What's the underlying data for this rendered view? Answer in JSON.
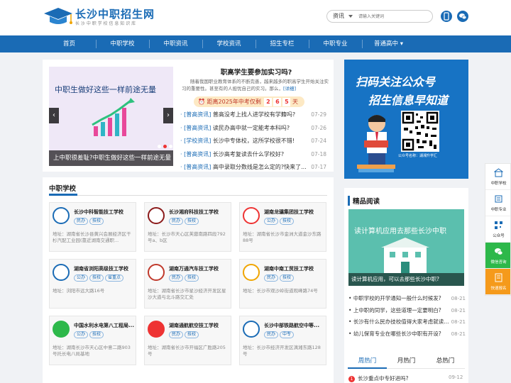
{
  "header": {
    "logo_title": "长沙中职招生网",
    "logo_sub": "长 沙 中 职 学 校 信 息 知 识 库",
    "search_category": "资讯",
    "search_placeholder": "请输入关键词",
    "icons": [
      "mobile-icon",
      "wechat-icon"
    ]
  },
  "nav": {
    "items": [
      "首页",
      "中职学校",
      "中职资讯",
      "学校资讯",
      "招生专栏",
      "中职专业",
      "普通高中"
    ]
  },
  "banner": {
    "title": "中职生做好这些一样前途无量",
    "caption": "上中职很羞耻?中职生做好这些一样前途无量",
    "prev": "‹",
    "next": "›"
  },
  "feature": {
    "title": "职高学生要参加实习吗?",
    "desc": "随着我国职业教育体系的不断完善，越来越多的职高学生开始关注实习的重要性。甚至有的人担忧自己的实习。那么，",
    "more": "[详细]",
    "countdown_label": "距离2025年中考仅剩",
    "countdown_digits": [
      "2",
      "6",
      "5"
    ],
    "countdown_unit": "天"
  },
  "news": [
    {
      "cat": "[普高资讯]",
      "title": "普高没考上找人进学校有学籍吗?",
      "date": "07-29"
    },
    {
      "cat": "[普高资讯]",
      "title": "读民办高中就一定能考本科吗?",
      "date": "07-26"
    },
    {
      "cat": "[学校资讯]",
      "title": "长沙中专体校，这所学校很不错!",
      "date": "07-24"
    },
    {
      "cat": "[普高资讯]",
      "title": "长沙高考复读去什么学校好?",
      "date": "07-18"
    },
    {
      "cat": "[普高资讯]",
      "title": "高中录取分数线是怎么定的?快来了...",
      "date": "07-17"
    }
  ],
  "qr": {
    "line1": "扫码关注公众号",
    "line2": "招生信息早知道",
    "caption": "公众号名称：湖湘升学汇"
  },
  "schools_section": {
    "title": "中职学校",
    "cards": [
      {
        "name": "长沙中科智能技工学校",
        "tags": [
          "民办",
          "技校"
        ],
        "addr": "地址：湖南省长沙县黄兴会展经济区干杉汽配工业园(靠近湖南交通职..."
      },
      {
        "name": "长沙湘府科技技工学校",
        "tags": [
          "民办",
          "技校"
        ],
        "addr": "地址：长沙市天心区芙蓉南路四段792号a、b区"
      },
      {
        "name": "湖南龙骧集团技工学校",
        "tags": [
          "公办",
          "技校"
        ],
        "addr": "地址：湖南省长沙市金洲大道金沙东路88号"
      },
      {
        "name": "湖南省浏阳高级技工学校",
        "tags": [
          "公办",
          "技校",
          "省重点"
        ],
        "addr": "地址：浏阳市远大路16号"
      },
      {
        "name": "湖南万通汽车技工学校",
        "tags": [
          "民办",
          "技校"
        ],
        "addr": "地址：湖南省长沙市星沙经济开发区星沙大道与北斗路交汇处"
      },
      {
        "name": "湖南中南工贸技工学校",
        "tags": [
          "民办",
          "技校"
        ],
        "addr": "地址：长沙市观沙岭街道观峰路74号"
      },
      {
        "name": "中国水利水电第八工程局...",
        "tags": [
          "公办",
          "技校"
        ],
        "addr": "地址：湖南长沙市天心区中意二路903号托长电八局基地"
      },
      {
        "name": "湖南通航航空技工学校",
        "tags": [
          "民办",
          "技校"
        ],
        "addr": "地址：湖南省长沙市开福区广胜路205号"
      },
      {
        "name": "长沙中部铁路航空中等...",
        "tags": [
          "民办",
          "中专"
        ],
        "addr": "地址：长沙市经济开发区漓湘东路128号"
      }
    ]
  },
  "reading": {
    "title": "精品阅读",
    "img_text": "读计算机应用去那些长沙中职",
    "img_caption": "读计算机应用，可以去那些长沙中职?",
    "items": [
      {
        "title": "中职学校的开学通知一般什么时候发?",
        "date": "08-21"
      },
      {
        "title": "上中职的同学，这些道理一定要明白?",
        "date": "08-21"
      },
      {
        "title": "长沙有什么民办技校值得大家考虑就读...",
        "date": "08-21"
      },
      {
        "title": "幼儿保育专业在哪些长沙中职有开设?",
        "date": "08-21"
      }
    ],
    "tabs": [
      "周热门",
      "月热门",
      "总热门"
    ],
    "hot": {
      "num": "1",
      "title": "长沙重点中专好进吗?",
      "date": "09-12"
    }
  },
  "float_bar": {
    "items": [
      {
        "label": "中职学校",
        "icon": "school-icon"
      },
      {
        "label": "中职专业",
        "icon": "major-icon"
      },
      {
        "label": "公众号",
        "icon": "qrcode-icon"
      },
      {
        "label": "微信咨询",
        "icon": "wechat-icon"
      },
      {
        "label": "快速报名",
        "icon": "signup-icon"
      }
    ]
  },
  "colors": {
    "primary": "#1a6bb5",
    "green": "#2db84a",
    "orange": "#f59a1b",
    "red": "#e33333"
  }
}
